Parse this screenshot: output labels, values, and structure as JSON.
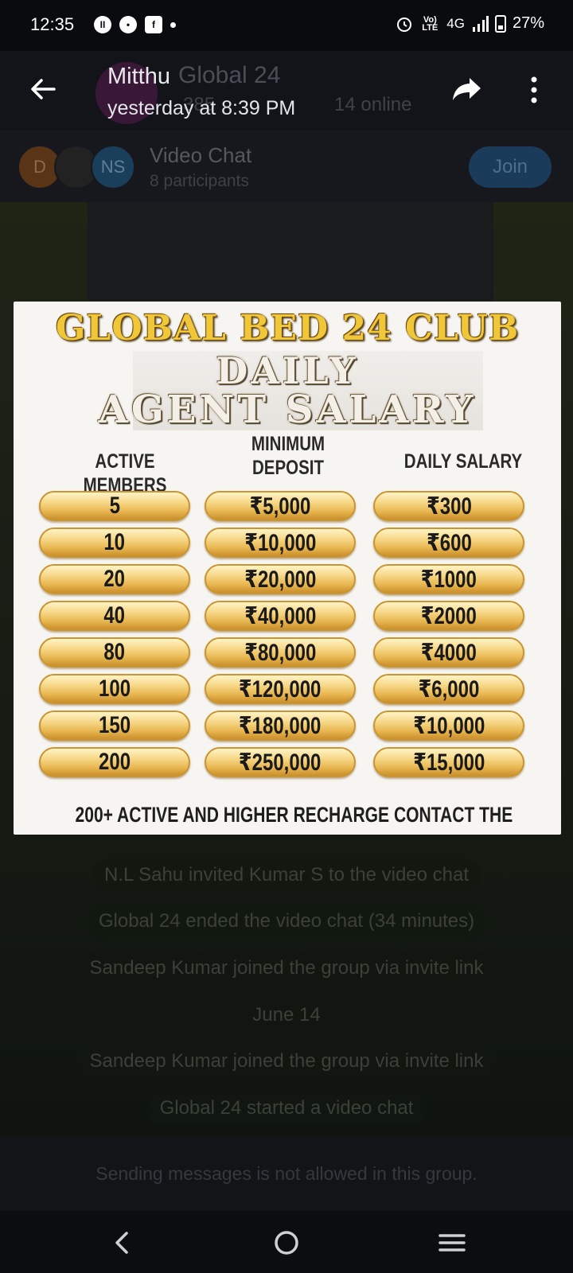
{
  "status_bar": {
    "time": "12:35",
    "left_icons": [
      "record-icon",
      "chat-icon",
      "facebook-icon",
      "dot-icon"
    ],
    "volte": "Vo) LTE",
    "network": "4G",
    "battery": "27%"
  },
  "chat_header": {
    "group_name": "Global 24",
    "members_partial": "385",
    "online": "14 online"
  },
  "viewer": {
    "sender": "Mitthu",
    "timestamp": "yesterday at 8:39 PM"
  },
  "video_chat": {
    "title": "Video Chat",
    "participants": "8 participants",
    "join_label": "Join",
    "avatars": [
      "D",
      "",
      "NS"
    ]
  },
  "promo": {
    "title": "GLOBAL BED 24 CLUB",
    "line1": "DAILY",
    "line2": "AGENT SALARY",
    "headers": [
      "ACTIVE MEMBERS",
      "MINIMUM DEPOSIT",
      "DAILY SALARY"
    ],
    "rows": [
      {
        "members": "5",
        "deposit": "₹5,000",
        "salary": "₹300"
      },
      {
        "members": "10",
        "deposit": "₹10,000",
        "salary": "₹600"
      },
      {
        "members": "20",
        "deposit": "₹20,000",
        "salary": "₹1000"
      },
      {
        "members": "40",
        "deposit": "₹40,000",
        "salary": "₹2000"
      },
      {
        "members": "80",
        "deposit": "₹80,000",
        "salary": "₹4000"
      },
      {
        "members": "100",
        "deposit": "₹120,000",
        "salary": "₹6,000"
      },
      {
        "members": "150",
        "deposit": "₹180,000",
        "salary": "₹10,000"
      },
      {
        "members": "200",
        "deposit": "₹250,000",
        "salary": "₹15,000"
      }
    ],
    "footer": "200+ ACTIVE AND HIGHER RECHARGE CONTACT THE"
  },
  "service_messages": [
    "N.L Sahu invited Kumar S to the video chat",
    "Global 24 ended the video chat (34 minutes)",
    "Sandeep Kumar joined the group via invite link",
    "June 14",
    "Sandeep Kumar joined the group via invite link",
    "Global 24 started a video chat"
  ],
  "bottom_notice": "Sending messages is not allowed in this group.",
  "nav": [
    "back-nav-icon",
    "home-nav-icon",
    "recents-nav-icon"
  ]
}
